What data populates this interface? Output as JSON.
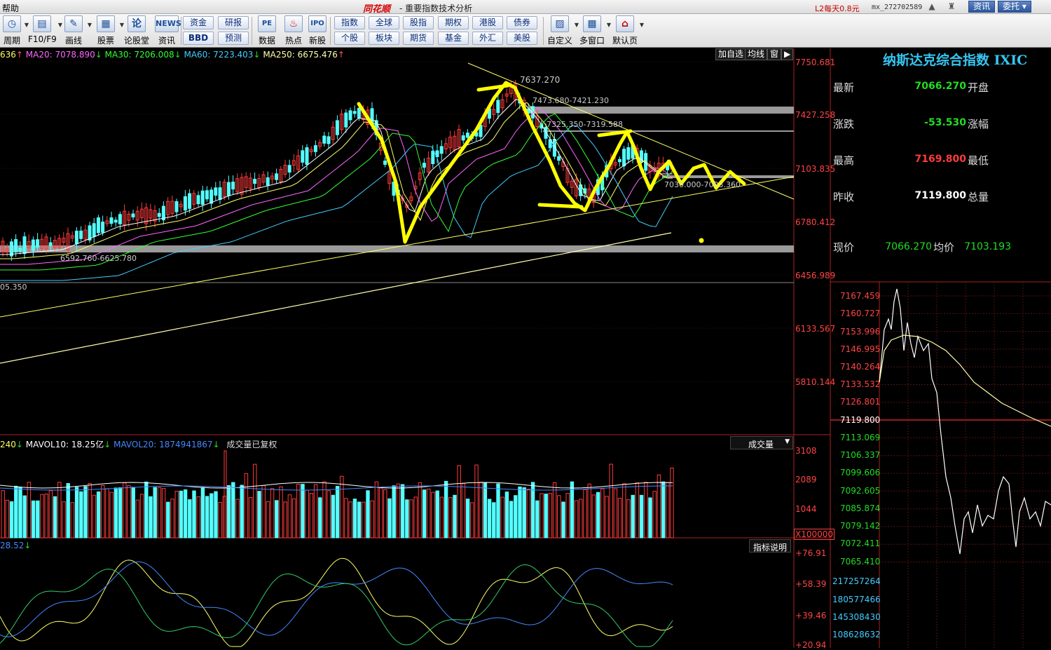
{
  "titlebar": {
    "menu": "帮助",
    "brand": "同花顺",
    "subtitle": "- 重要指数技术分析",
    "promo": "L2每天0.8元",
    "account": "mx_272702589",
    "bell_icon": "bell-icon",
    "shirt_icon": "shirt-icon",
    "news_button": "资讯",
    "trust_button": "委托"
  },
  "toolbar": {
    "tools": [
      {
        "label": "周期",
        "icon": "cycle-icon"
      },
      {
        "label": "F10/F9",
        "icon": "f10-icon"
      },
      {
        "label": "画线",
        "icon": "pen-icon"
      },
      {
        "label": "股票",
        "icon": "stock-icon"
      },
      {
        "label": "论股堂",
        "icon": "forum-icon"
      },
      {
        "label": "资讯",
        "icon": "news-icon"
      },
      {
        "label": "数据",
        "icon": "pe-icon"
      },
      {
        "label": "热点",
        "icon": "hot-icon"
      },
      {
        "label": "新股",
        "icon": "ipo-icon"
      },
      {
        "label": "自定义",
        "icon": "customize-icon"
      },
      {
        "label": "多窗口",
        "icon": "multi-window-icon"
      },
      {
        "label": "默认页",
        "icon": "home-icon"
      }
    ],
    "small_buttons": [
      [
        "资金",
        "研报"
      ],
      [
        "BBD",
        "预测"
      ],
      [
        "指数",
        "全球",
        "股指",
        "期权",
        "港股",
        "债券"
      ],
      [
        "个股",
        "板块",
        "期货",
        "基金",
        "外汇",
        "美股"
      ]
    ]
  },
  "main_chart": {
    "ma_legend": {
      "ma_first_tail": "636",
      "ma20": "MA20: 7078.890",
      "ma30": "MA30: 7206.008",
      "ma60": "MA60: 7223.403",
      "ma250": "MA250: 6675.476"
    },
    "header_buttons": [
      "加自选",
      "均线",
      "窗"
    ],
    "price_axis": [
      "7750.681",
      "7427.258",
      "7103.835",
      "6780.412",
      "6456.989",
      "6133.567",
      "5810.144"
    ],
    "annotations": {
      "peak": "7637.270",
      "zone1": "7473.680-7421.230",
      "zone2": "7325.350-7319.588",
      "zone3": "7030.000-7003.360",
      "zone4": "6592.760-6625.780",
      "left_value": "05.350"
    }
  },
  "volume": {
    "legend": {
      "first_tail": "240",
      "mavol10": "MAVOL10: 18.25亿",
      "mavol20": "MAVOL20: 1874941867",
      "note": "成交量已复权"
    },
    "selector": "成交量",
    "axis": [
      "3108",
      "2089",
      "1044"
    ],
    "unit": "X100000"
  },
  "indicator": {
    "legend": "28.52",
    "help_button": "指标说明",
    "axis": [
      "+76.91",
      "+58.39",
      "+39.46",
      "+20.94"
    ]
  },
  "quote": {
    "name": "纳斯达克综合指数 IXIC",
    "rows": [
      {
        "label": "最新",
        "value": "7066.270",
        "right_label": "开盘",
        "color": "#22dd22"
      },
      {
        "label": "涨跌",
        "value": "-53.530",
        "right_label": "涨幅",
        "color": "#22dd22"
      },
      {
        "label": "最高",
        "value": "7169.800",
        "right_label": "最低",
        "color": "#ff3b3b"
      },
      {
        "label": "昨收",
        "value": "7119.800",
        "right_label": "总量",
        "color": "#ffffff"
      }
    ],
    "current_label": "现价",
    "current_value": "7066.270",
    "avg_label": "均价",
    "avg_value": "7103.193"
  },
  "intraday": {
    "price_axis": [
      "7167.459",
      "7160.727",
      "7153.996",
      "7146.995",
      "7140.264",
      "7133.532",
      "7126.801",
      "7119.800",
      "7113.069",
      "7106.337",
      "7099.606",
      "7092.605",
      "7085.874",
      "7079.142",
      "7072.411",
      "7065.410"
    ],
    "volume_axis": [
      "217257264",
      "180577466",
      "145308430",
      "108628632"
    ]
  }
}
